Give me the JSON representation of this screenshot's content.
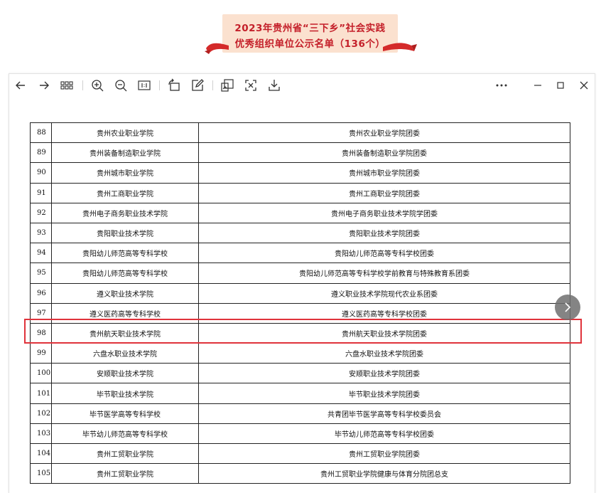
{
  "banner": {
    "line1": "2023年贵州省“三下乡”社会实践",
    "line2": "优秀组织单位公示名单（136个）",
    "color": "#c4202a",
    "background": "#fbe1cf"
  },
  "toolbar": {
    "icons": [
      "arrow-left-icon",
      "arrow-right-icon",
      "grid-icon",
      "zoom-in-icon",
      "zoom-out-icon",
      "actual-size-icon",
      "rotate-icon",
      "edit-icon",
      "copy-image-icon",
      "fullscreen-icon",
      "download-icon",
      "more-icon",
      "minimize-icon",
      "maximize-icon",
      "close-icon"
    ]
  },
  "table": {
    "rows": [
      {
        "num": "88",
        "school": "贵州农业职业学院",
        "unit": "贵州农业职业学院团委"
      },
      {
        "num": "89",
        "school": "贵州装备制造职业学院",
        "unit": "贵州装备制造职业学院团委"
      },
      {
        "num": "90",
        "school": "贵州城市职业学院",
        "unit": "贵州城市职业学院团委"
      },
      {
        "num": "91",
        "school": "贵州工商职业学院",
        "unit": "贵州工商职业学院团委"
      },
      {
        "num": "92",
        "school": "贵州电子商务职业技术学院",
        "unit": "贵州电子商务职业技术学院学团委"
      },
      {
        "num": "93",
        "school": "贵阳职业技术学院",
        "unit": "贵阳职业技术学院团委"
      },
      {
        "num": "94",
        "school": "贵阳幼儿师范高等专科学校",
        "unit": "贵阳幼儿师范高等专科学校团委"
      },
      {
        "num": "95",
        "school": "贵阳幼儿师范高等专科学校",
        "unit": "贵阳幼儿师范高等专科学校学前教育与特殊教育系团委"
      },
      {
        "num": "96",
        "school": "遵义职业技术学院",
        "unit": "遵义职业技术学院现代农业系团委"
      },
      {
        "num": "97",
        "school": "遵义医药高等专科学校",
        "unit": "遵义医药高等专科学校团委"
      },
      {
        "num": "98",
        "school": "贵州航天职业技术学院",
        "unit": "贵州航天职业技术学院团委"
      },
      {
        "num": "99",
        "school": "六盘水职业技术学院",
        "unit": "六盘水职业技术学院团委"
      },
      {
        "num": "100",
        "school": "安顺职业技术学院",
        "unit": "安顺职业技术学院团委"
      },
      {
        "num": "101",
        "school": "毕节职业技术学院",
        "unit": "毕节职业技术学院团委"
      },
      {
        "num": "102",
        "school": "毕节医学高等专科学校",
        "unit": "共青团毕节医学高等专科学校委员会"
      },
      {
        "num": "103",
        "school": "毕节幼儿师范高等专科学校",
        "unit": "毕节幼儿师范高等专科学校团委"
      },
      {
        "num": "104",
        "school": "贵州工贸职业学院",
        "unit": "贵州工贸职业学院团委"
      },
      {
        "num": "105",
        "school": "贵州工贸职业学院",
        "unit": "贵州工贸职业学院健康与体育分院团总支"
      }
    ],
    "highlight_color": "#e0333b"
  }
}
